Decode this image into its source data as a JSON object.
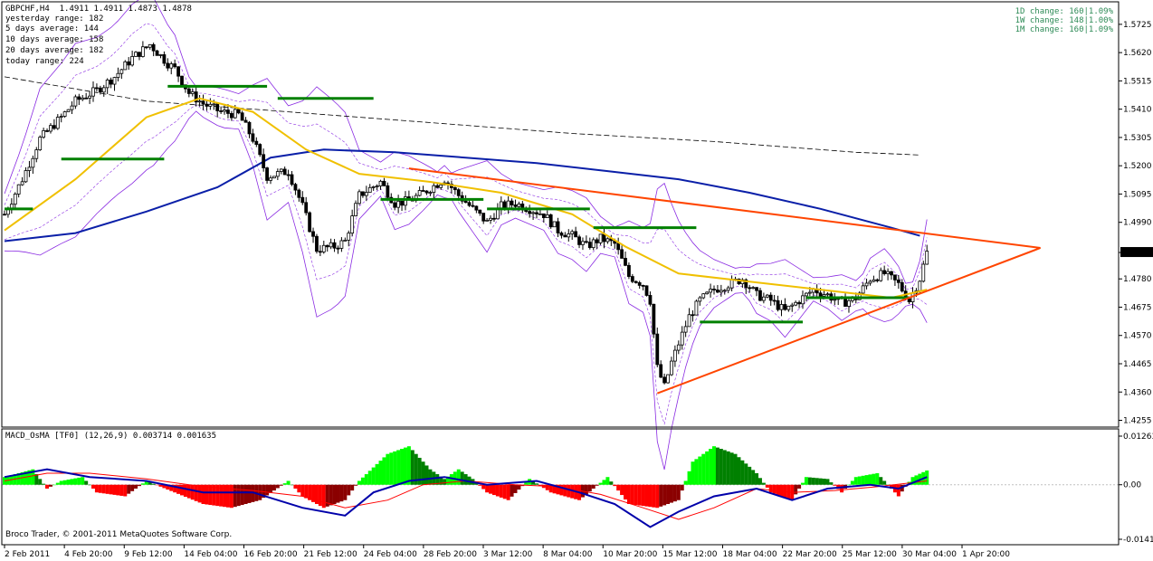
{
  "header": {
    "title": "GBPCHF,H4  1.4911 1.4911 1.4873 1.4878",
    "stats": [
      "yesterday range: 182",
      "5 days average: 144",
      "10 days average: 158",
      "20 days average: 182",
      "today range: 224"
    ]
  },
  "changes": [
    "1D change: 160|1.09%",
    "1W change: 148|1.00%",
    "1M change: 160|1.09%"
  ],
  "copyright": "Broco Trader, © 2001-2011 MetaQuotes Software Corp.",
  "current_price_label": "1.4878",
  "colors": {
    "bull_candle": "#000000",
    "bear_candle": "#000000",
    "ma_yellow": "#f0c000",
    "ma_blue": "#0a1fa8",
    "envelope": "#8a2be2",
    "pivot_green": "#008000",
    "triangle": "#ff4500",
    "macd_pos_up": "#00ff00",
    "macd_pos_dn": "#008000",
    "macd_neg_dn": "#ff0000",
    "macd_neg_up": "#8b0000",
    "macd_line": "#0000aa",
    "signal_line": "#ff0000"
  },
  "chart_data": [
    {
      "type": "candlestick",
      "symbol": "GBPCHF",
      "timeframe": "H4",
      "ylim": [
        1.425,
        1.5775
      ],
      "y_ticks": [
        "1.5725",
        "1.5620",
        "1.5515",
        "1.5410",
        "1.5305",
        "1.5200",
        "1.5095",
        "1.4990",
        "1.4878",
        "1.4780",
        "1.4675",
        "1.4570",
        "1.4465",
        "1.4360",
        "1.4255"
      ],
      "x_ticks": [
        "2 Feb 2011",
        "4 Feb 20:00",
        "9 Feb 12:00",
        "14 Feb 04:00",
        "16 Feb 20:00",
        "21 Feb 12:00",
        "24 Feb 04:00",
        "28 Feb 20:00",
        "3 Mar 12:00",
        "8 Mar 04:00",
        "10 Mar 20:00",
        "15 Mar 12:00",
        "18 Mar 04:00",
        "22 Mar 20:00",
        "25 Mar 12:00",
        "30 Mar 04:00",
        "1 Apr 20:00"
      ],
      "anchor_closes": [
        [
          0,
          1.502
        ],
        [
          5,
          1.515
        ],
        [
          10,
          1.53
        ],
        [
          16,
          1.538
        ],
        [
          20,
          1.544
        ],
        [
          26,
          1.548
        ],
        [
          31,
          1.553
        ],
        [
          36,
          1.56
        ],
        [
          41,
          1.565
        ],
        [
          46,
          1.558
        ],
        [
          48,
          1.556
        ],
        [
          52,
          1.547
        ],
        [
          56,
          1.543
        ],
        [
          61,
          1.54
        ],
        [
          66,
          1.539
        ],
        [
          70,
          1.53
        ],
        [
          74,
          1.516
        ],
        [
          80,
          1.518
        ],
        [
          84,
          1.505
        ],
        [
          88,
          1.489
        ],
        [
          93,
          1.49
        ],
        [
          96,
          1.492
        ],
        [
          100,
          1.509
        ],
        [
          106,
          1.514
        ],
        [
          110,
          1.506
        ],
        [
          114,
          1.507
        ],
        [
          118,
          1.51
        ],
        [
          124,
          1.515
        ],
        [
          128,
          1.509
        ],
        [
          132,
          1.504
        ],
        [
          136,
          1.499
        ],
        [
          140,
          1.505
        ],
        [
          144,
          1.506
        ],
        [
          148,
          1.504
        ],
        [
          152,
          1.502
        ],
        [
          156,
          1.496
        ],
        [
          160,
          1.494
        ],
        [
          164,
          1.49
        ],
        [
          168,
          1.493
        ],
        [
          172,
          1.491
        ],
        [
          176,
          1.479
        ],
        [
          180,
          1.476
        ],
        [
          182,
          1.47
        ],
        [
          184,
          1.445
        ],
        [
          186,
          1.438
        ],
        [
          188,
          1.447
        ],
        [
          190,
          1.454
        ],
        [
          193,
          1.464
        ],
        [
          196,
          1.47
        ],
        [
          200,
          1.474
        ],
        [
          204,
          1.476
        ],
        [
          208,
          1.478
        ],
        [
          212,
          1.472
        ],
        [
          216,
          1.47
        ],
        [
          220,
          1.466
        ],
        [
          224,
          1.47
        ],
        [
          228,
          1.474
        ],
        [
          232,
          1.472
        ],
        [
          236,
          1.469
        ],
        [
          240,
          1.471
        ],
        [
          244,
          1.478
        ],
        [
          248,
          1.48
        ],
        [
          252,
          1.476
        ],
        [
          255,
          1.47
        ],
        [
          258,
          1.478
        ],
        [
          260,
          1.4878
        ]
      ],
      "lines": {
        "ma_yellow": [
          [
            0,
            1.496
          ],
          [
            20,
            1.515
          ],
          [
            40,
            1.538
          ],
          [
            55,
            1.545
          ],
          [
            70,
            1.54
          ],
          [
            85,
            1.526
          ],
          [
            100,
            1.517
          ],
          [
            120,
            1.514
          ],
          [
            140,
            1.51
          ],
          [
            160,
            1.502
          ],
          [
            175,
            1.49
          ],
          [
            190,
            1.48
          ],
          [
            210,
            1.477
          ],
          [
            230,
            1.474
          ],
          [
            250,
            1.471
          ],
          [
            260,
            1.474
          ]
        ],
        "ma_blue": [
          [
            0,
            1.492
          ],
          [
            20,
            1.495
          ],
          [
            40,
            1.503
          ],
          [
            60,
            1.512
          ],
          [
            75,
            1.523
          ],
          [
            90,
            1.526
          ],
          [
            110,
            1.525
          ],
          [
            130,
            1.523
          ],
          [
            150,
            1.521
          ],
          [
            170,
            1.518
          ],
          [
            190,
            1.515
          ],
          [
            210,
            1.51
          ],
          [
            230,
            1.504
          ],
          [
            250,
            1.497
          ],
          [
            258,
            1.494
          ]
        ],
        "ma_dashed": [
          [
            0,
            1.553
          ],
          [
            40,
            1.544
          ],
          [
            80,
            1.54
          ],
          [
            120,
            1.536
          ],
          [
            160,
            1.532
          ],
          [
            200,
            1.529
          ],
          [
            240,
            1.525
          ],
          [
            258,
            1.524
          ]
        ],
        "triangle_upper": [
          [
            114,
            1.519
          ],
          [
            292,
            1.4895
          ]
        ],
        "triangle_lower": [
          [
            184,
            1.4355
          ],
          [
            292,
            1.4895
          ]
        ]
      },
      "pivots": [
        [
          0,
          8,
          1.504
        ],
        [
          16,
          45,
          1.5225
        ],
        [
          46,
          74,
          1.5495
        ],
        [
          77,
          104,
          1.545
        ],
        [
          106,
          135,
          1.5075
        ],
        [
          136,
          165,
          1.504
        ],
        [
          166,
          195,
          1.497
        ],
        [
          196,
          225,
          1.462
        ],
        [
          226,
          255,
          1.471
        ]
      ]
    },
    {
      "type": "histogram",
      "name": "MACD_OsMA [TF0] (12,26,9) 0.003714 0.001635",
      "ylim": [
        -0.01417,
        0.01263
      ],
      "y_ticks": [
        "0.01263",
        "0.00",
        "-0.01417"
      ],
      "hist_anchors": [
        [
          0,
          0.002
        ],
        [
          8,
          0.004
        ],
        [
          12,
          -0.001
        ],
        [
          16,
          0.001
        ],
        [
          22,
          0.002
        ],
        [
          26,
          -0.002
        ],
        [
          34,
          -0.003
        ],
        [
          40,
          0.001
        ],
        [
          48,
          -0.002
        ],
        [
          56,
          -0.005
        ],
        [
          64,
          -0.006
        ],
        [
          72,
          -0.004
        ],
        [
          80,
          0.001
        ],
        [
          84,
          -0.003
        ],
        [
          90,
          -0.006
        ],
        [
          96,
          -0.004
        ],
        [
          100,
          0.001
        ],
        [
          108,
          0.008
        ],
        [
          114,
          0.01
        ],
        [
          120,
          0.004
        ],
        [
          124,
          0.0015
        ],
        [
          128,
          0.004
        ],
        [
          132,
          0.0015
        ],
        [
          136,
          -0.002
        ],
        [
          142,
          -0.004
        ],
        [
          148,
          0.0015
        ],
        [
          154,
          -0.002
        ],
        [
          158,
          -0.003
        ],
        [
          162,
          -0.004
        ],
        [
          170,
          0.002
        ],
        [
          176,
          -0.005
        ],
        [
          184,
          -0.006
        ],
        [
          190,
          -0.004
        ],
        [
          194,
          0.006
        ],
        [
          200,
          0.01
        ],
        [
          206,
          0.008
        ],
        [
          212,
          0.003
        ],
        [
          216,
          -0.002
        ],
        [
          222,
          -0.004
        ],
        [
          226,
          0.002
        ],
        [
          232,
          0.0015
        ],
        [
          236,
          -0.002
        ],
        [
          240,
          0.002
        ],
        [
          246,
          0.003
        ],
        [
          252,
          -0.003
        ],
        [
          256,
          0.002
        ],
        [
          260,
          0.0037
        ]
      ],
      "macd_line": [
        [
          0,
          0.002
        ],
        [
          12,
          0.004
        ],
        [
          24,
          0.002
        ],
        [
          40,
          0.001
        ],
        [
          56,
          -0.002
        ],
        [
          70,
          -0.002
        ],
        [
          84,
          -0.006
        ],
        [
          96,
          -0.008
        ],
        [
          104,
          -0.002
        ],
        [
          114,
          0.001
        ],
        [
          124,
          0.002
        ],
        [
          136,
          0.0
        ],
        [
          150,
          0.001
        ],
        [
          162,
          -0.002
        ],
        [
          172,
          -0.005
        ],
        [
          182,
          -0.011
        ],
        [
          190,
          -0.007
        ],
        [
          200,
          -0.003
        ],
        [
          212,
          -0.001
        ],
        [
          222,
          -0.004
        ],
        [
          232,
          -0.001
        ],
        [
          244,
          0.0
        ],
        [
          252,
          -0.001
        ],
        [
          260,
          0.002
        ]
      ],
      "signal_line": [
        [
          0,
          0.001
        ],
        [
          12,
          0.003
        ],
        [
          24,
          0.003
        ],
        [
          40,
          0.0015
        ],
        [
          56,
          -0.0005
        ],
        [
          70,
          -0.0015
        ],
        [
          84,
          -0.003
        ],
        [
          96,
          -0.006
        ],
        [
          108,
          -0.004
        ],
        [
          118,
          0.0
        ],
        [
          130,
          0.001
        ],
        [
          144,
          0.0
        ],
        [
          156,
          -0.0005
        ],
        [
          168,
          -0.0025
        ],
        [
          180,
          -0.006
        ],
        [
          190,
          -0.009
        ],
        [
          200,
          -0.006
        ],
        [
          212,
          -0.001
        ],
        [
          222,
          -0.002
        ],
        [
          234,
          -0.0015
        ],
        [
          246,
          -0.0005
        ],
        [
          260,
          0.001
        ]
      ]
    }
  ]
}
